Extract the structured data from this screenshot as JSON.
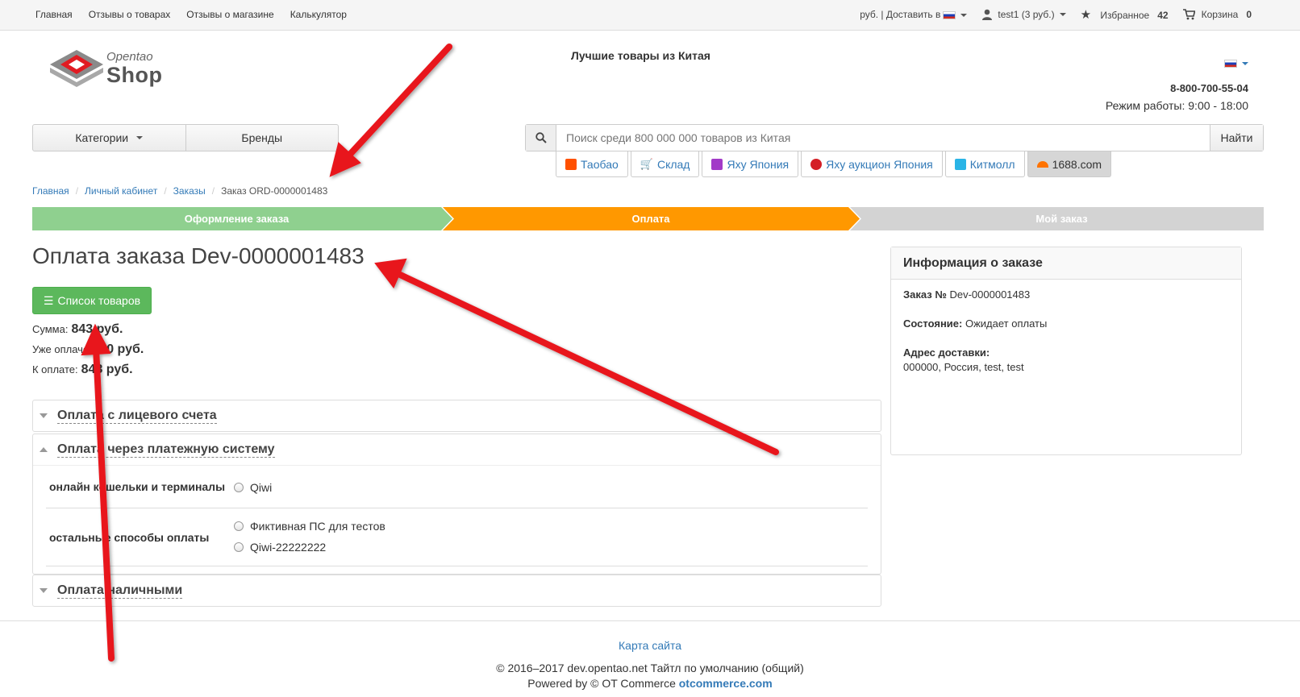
{
  "topbar": {
    "nav": [
      "Главная",
      "Отзывы о товарах",
      "Отзывы о магазине",
      "Калькулятор"
    ],
    "currency_delivery": "руб. | Доставить в",
    "user": "test1 (3 руб.)",
    "favorites_label": "Избранное",
    "favorites_count": "42",
    "cart_label": "Корзина",
    "cart_count": "0"
  },
  "header": {
    "logo_top": "Opentao",
    "logo_bottom": "Shop",
    "slogan": "Лучшие товары из Китая",
    "phone": "8-800-700-55-04",
    "hours": "Режим работы: 9:00 - 18:00"
  },
  "catbar": {
    "categories": "Категории",
    "brands": "Бренды"
  },
  "search": {
    "placeholder": "Поиск среди 800 000 000 товаров из Китая",
    "button": "Найти",
    "providers": [
      "Таобао",
      "Склад",
      "Яху Япония",
      "Яху аукцион Япония",
      "Китмолл",
      "1688.com"
    ]
  },
  "breadcrumb": [
    "Главная",
    "Личный кабинет",
    "Заказы",
    "Заказ ORD-0000001483"
  ],
  "steps": [
    "Оформление заказа",
    "Оплата",
    "Мой заказ"
  ],
  "main": {
    "title": "Оплата заказа Dev-0000001483",
    "list_button": "Список товаров",
    "sum_label": "Сумма:",
    "sum_value": "843 руб.",
    "paid_label": "Уже оплачено:",
    "paid_value": "0 руб.",
    "due_label": "К оплате:",
    "due_value": "843 руб."
  },
  "payment": {
    "account": "Оплата с лицевого счета",
    "system": "Оплата через платежную систему",
    "group1_label": "онлайн кошельки и терминалы",
    "group1_options": [
      "Qiwi"
    ],
    "group2_label": "остальные способы оплаты",
    "group2_options": [
      "Фиктивная ПС для тестов",
      "Qiwi-22222222"
    ],
    "cash": "Оплата наличными"
  },
  "info": {
    "title": "Информация о заказе",
    "order_label": "Заказ №",
    "order_value": "Dev-0000001483",
    "status_label": "Состояние:",
    "status_value": "Ожидает оплаты",
    "address_label": "Адрес доставки:",
    "address_value": "000000, Россия, test, test"
  },
  "footer": {
    "sitemap": "Карта сайта",
    "copyright": "© 2016–2017 dev.opentao.net Тайтл по умолчанию (общий)",
    "powered": "Powered by © OT Commerce",
    "powered_link": "otcommerce.com"
  },
  "colors": {
    "step_done": "#8fd08f",
    "step_active": "#ff9800",
    "step_todo": "#d3d3d3",
    "green_button": "#5cb85c",
    "link": "#337ab7",
    "annotation_arrow": "#e8141b"
  }
}
